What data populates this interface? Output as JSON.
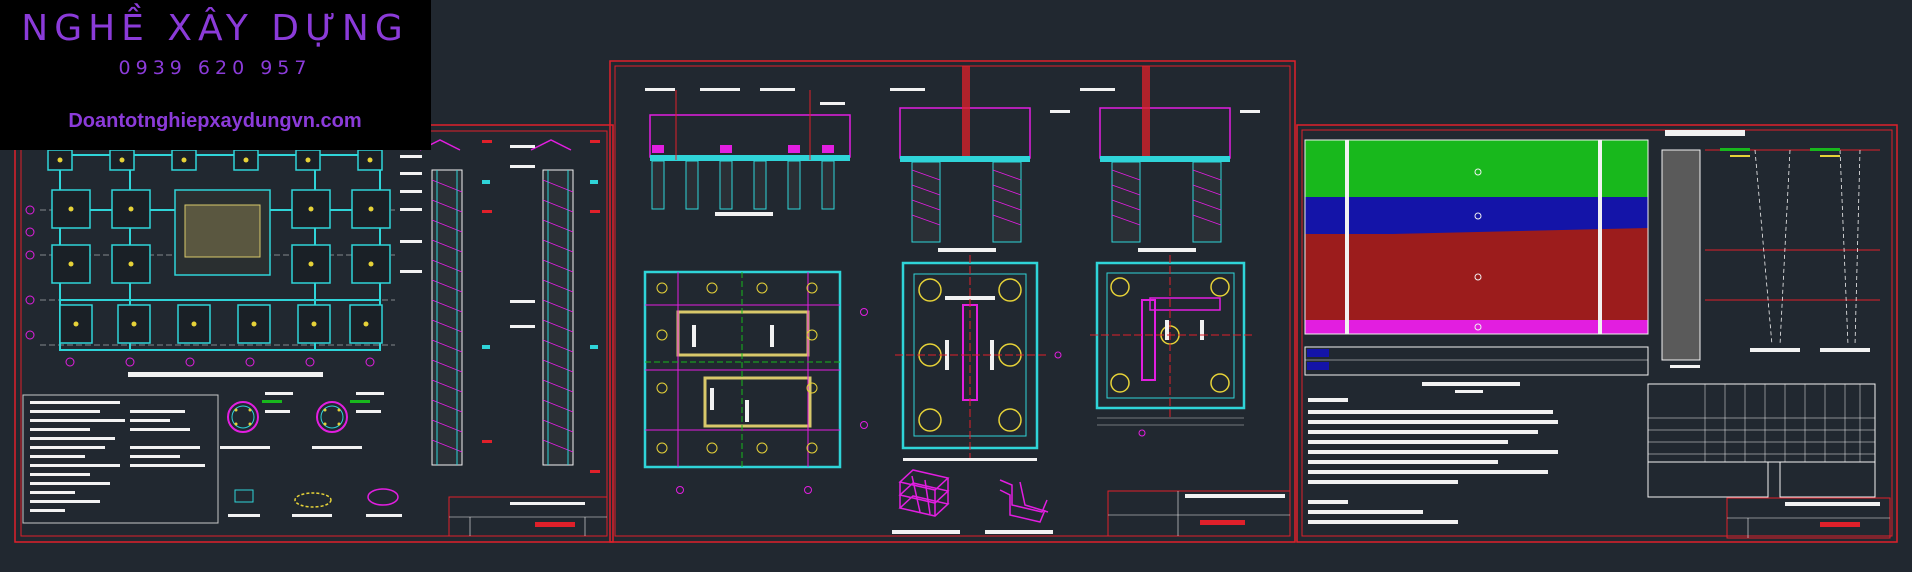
{
  "brand": {
    "title": "NGHỀ XÂY DỰNG",
    "phone": "0939 620 957",
    "website": "Doantotnghiepxaydungvn.com"
  },
  "colors": {
    "background": "#212830",
    "frame": "#e0202a",
    "cyan": "#2fd4d8",
    "magenta": "#e21ee0",
    "yellow": "#e6d238",
    "white": "#f2f2f2",
    "green": "#18b81c",
    "blue": "#1414a8",
    "red": "#9c1c1c",
    "brand": "#8b3bd9"
  },
  "sheets": [
    {
      "name": "foundation-plan-sheet"
    },
    {
      "name": "pile-cap-detail-sheet"
    },
    {
      "name": "soil-profile-sheet"
    }
  ]
}
